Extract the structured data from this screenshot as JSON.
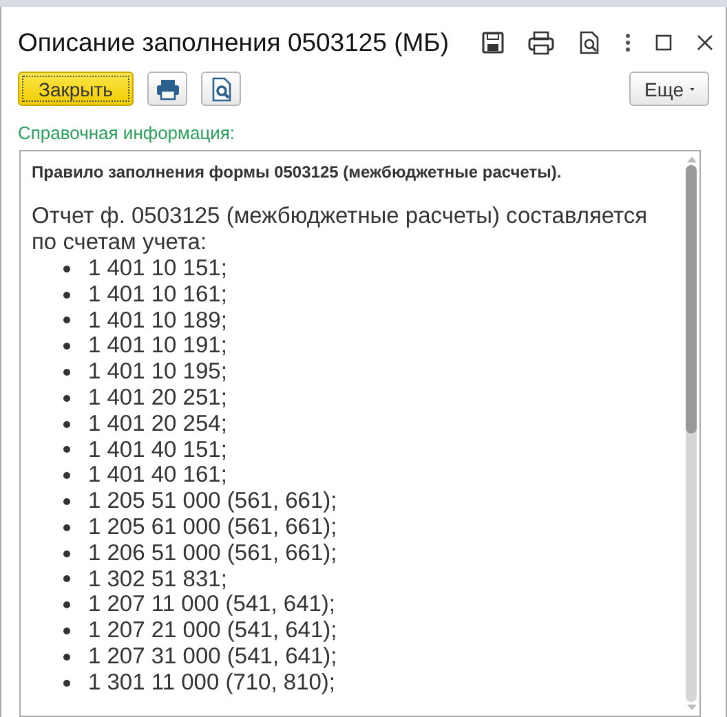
{
  "window": {
    "title": "Описание заполнения 0503125 (МБ)"
  },
  "toolbar": {
    "close_button": "Закрыть",
    "more_button": "Еще"
  },
  "section_label": "Справочная информация:",
  "document": {
    "heading": "Правило заполнения формы 0503125 (межбюджетные расчеты).",
    "intro": "Отчет ф. 0503125 (межбюджетные расчеты) составляется по счетам учета:",
    "accounts": [
      "1 401 10 151;",
      "1 401 10 161;",
      "1 401 10 189;",
      "1 401 10 191;",
      "1 401 10 195;",
      "1 401 20 251;",
      "1 401 20 254;",
      "1 401 40 151;",
      "1 401 40 161;",
      "1 205 51 000 (561, 661);",
      "1 205 61 000 (561, 661);",
      "1 206 51 000 (561, 661);",
      "1 302 51 831;",
      "1 207 11 000 (541, 641);",
      "1 207 21 000 (541, 641);",
      "1 207 31 000 (541, 641);",
      "1 301 11 000 (710, 810);"
    ]
  }
}
